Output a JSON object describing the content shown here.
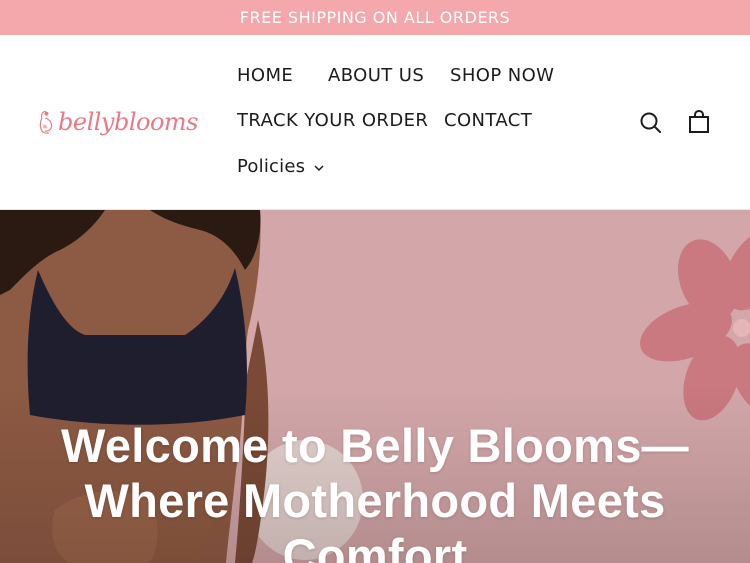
{
  "announcement": {
    "text": "FREE SHIPPING ON ALL ORDERS"
  },
  "brand": {
    "logo_text": "bellyblooms",
    "accent_color": "#e77a86",
    "announce_bg": "#f5a8ab"
  },
  "nav": {
    "items": [
      {
        "label": "HOME"
      },
      {
        "label": "ABOUT US"
      },
      {
        "label": "SHOP NOW"
      },
      {
        "label": "TRACK YOUR ORDER"
      },
      {
        "label": "CONTACT"
      }
    ],
    "policies": {
      "label": "Policies",
      "icon": "chevron-down-icon"
    }
  },
  "header_icons": {
    "search": "search-icon",
    "cart": "cart-icon"
  },
  "hero": {
    "title": "Welcome to Belly Blooms—Where Motherhood Meets Comfort",
    "background_color": "#d3a7a9",
    "flower_color": "#c9797f"
  }
}
